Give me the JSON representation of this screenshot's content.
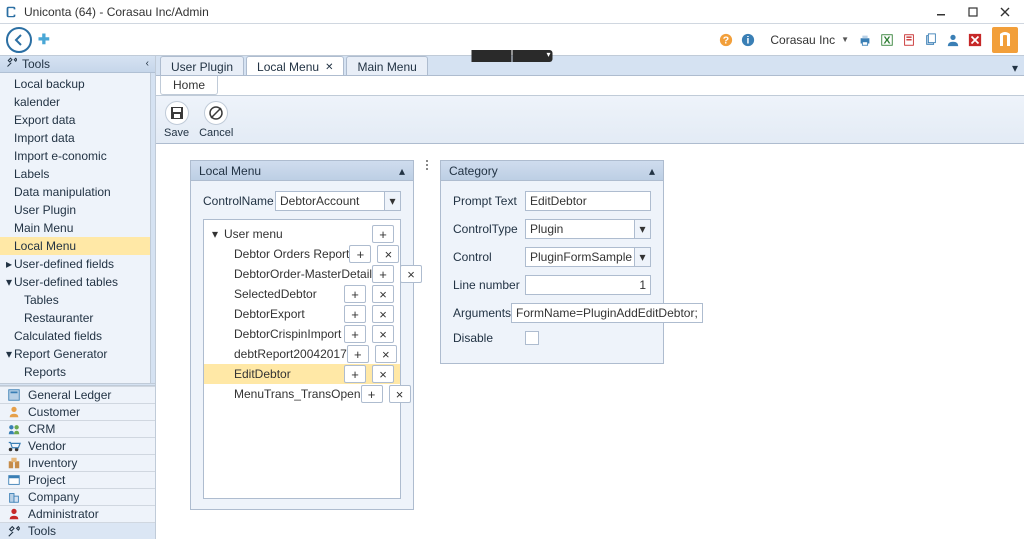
{
  "window": {
    "title": "Uniconta (64)  - Corasau Inc/Admin",
    "brand": "Corasau Inc"
  },
  "center_tabs": [
    "",
    ""
  ],
  "sidebar": {
    "header": "Tools",
    "items": [
      {
        "label": "Local backup"
      },
      {
        "label": "kalender"
      },
      {
        "label": "Export data"
      },
      {
        "label": "Import data"
      },
      {
        "label": "Import e-conomic"
      },
      {
        "label": "Labels"
      },
      {
        "label": "Data manipulation"
      },
      {
        "label": "User Plugin"
      },
      {
        "label": "Main Menu"
      },
      {
        "label": "Local Menu",
        "selected": true
      },
      {
        "label": "User-defined fields",
        "expander": true
      },
      {
        "label": "User-defined tables",
        "expander": true,
        "expanded": true,
        "children": [
          {
            "label": "Tables"
          },
          {
            "label": "Restauranter"
          }
        ]
      },
      {
        "label": "Calculated fields"
      },
      {
        "label": "Report Generator",
        "expander": true,
        "expanded": true,
        "children": [
          {
            "label": "Reports"
          }
        ]
      }
    ],
    "modules": [
      {
        "label": "General Ledger",
        "icon": "ledger-icon"
      },
      {
        "label": "Customer",
        "icon": "customer-icon"
      },
      {
        "label": "CRM",
        "icon": "crm-icon"
      },
      {
        "label": "Vendor",
        "icon": "vendor-icon"
      },
      {
        "label": "Inventory",
        "icon": "inventory-icon"
      },
      {
        "label": "Project",
        "icon": "project-icon"
      },
      {
        "label": "Company",
        "icon": "company-icon"
      },
      {
        "label": "Administrator",
        "icon": "admin-icon"
      },
      {
        "label": "Tools",
        "icon": "tools-icon",
        "active": true
      }
    ]
  },
  "tabs": [
    {
      "label": "User Plugin"
    },
    {
      "label": "Local Menu",
      "active": true,
      "closable": true
    },
    {
      "label": "Main Menu"
    }
  ],
  "subtab": {
    "label": "Home"
  },
  "ribbon": {
    "save": "Save",
    "cancel": "Cancel"
  },
  "local_menu_panel": {
    "title": "Local Menu",
    "control_name_label": "ControlName",
    "control_name_value": "DebtorAccount",
    "root": "User menu",
    "children": [
      {
        "label": "Debtor Orders Report"
      },
      {
        "label": "DebtorOrder-MasterDetail"
      },
      {
        "label": "SelectedDebtor"
      },
      {
        "label": "DebtorExport"
      },
      {
        "label": "DebtorCrispinImport"
      },
      {
        "label": "debtReport20042017"
      },
      {
        "label": "EditDebtor",
        "selected": true
      },
      {
        "label": "MenuTrans_TransOpen"
      }
    ]
  },
  "category_panel": {
    "title": "Category",
    "fields": {
      "prompt_text_label": "Prompt Text",
      "prompt_text_value": "EditDebtor",
      "control_type_label": "ControlType",
      "control_type_value": "Plugin",
      "control_label": "Control",
      "control_value": "PluginFormSample",
      "line_number_label": "Line number",
      "line_number_value": "1",
      "arguments_label": "Arguments",
      "arguments_value": "FormName=PluginAddEditDebtor;",
      "disable_label": "Disable"
    }
  }
}
